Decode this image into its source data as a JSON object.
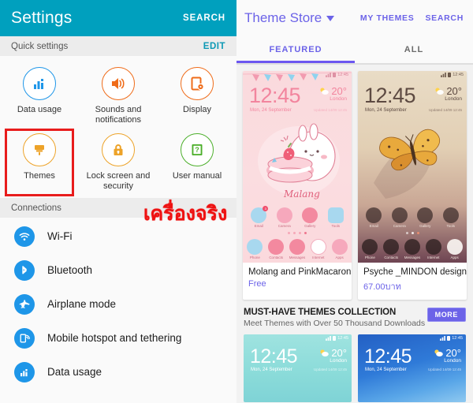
{
  "settings": {
    "header": {
      "title": "Settings",
      "search_label": "SEARCH",
      "bg_color": "#00a0be"
    },
    "quick_settings": {
      "section_label": "Quick settings",
      "edit_label": "EDIT",
      "items": [
        {
          "label": "Data usage",
          "icon": "bar-chart-icon",
          "color": "#1e96e8",
          "highlighted": false
        },
        {
          "label": "Sounds and notifications",
          "icon": "speaker-icon",
          "color": "#ef6c1a",
          "highlighted": false
        },
        {
          "label": "Display",
          "icon": "display-icon",
          "color": "#ef6c1a",
          "highlighted": false
        },
        {
          "label": "Themes",
          "icon": "paintbrush-icon",
          "color": "#eda329",
          "highlighted": true
        },
        {
          "label": "Lock screen and security",
          "icon": "lock-icon",
          "color": "#eda329",
          "highlighted": false
        },
        {
          "label": "User manual",
          "icon": "manual-icon",
          "color": "#4caf2b",
          "highlighted": false
        }
      ],
      "highlight_color": "#e81c1c"
    },
    "connections": {
      "section_label": "Connections",
      "items": [
        {
          "label": "Wi-Fi",
          "icon": "wifi-icon"
        },
        {
          "label": "Bluetooth",
          "icon": "bluetooth-icon"
        },
        {
          "label": "Airplane mode",
          "icon": "airplane-icon"
        },
        {
          "label": "Mobile hotspot and tethering",
          "icon": "hotspot-icon"
        },
        {
          "label": "Data usage",
          "icon": "bar-chart-icon"
        }
      ],
      "icon_color": "#1e96e8"
    },
    "annotation": {
      "text": "เครื่องจริง",
      "color": "#ee1111"
    }
  },
  "store": {
    "header": {
      "title": "Theme Store",
      "my_themes_label": "MY THEMES",
      "search_label": "SEARCH",
      "accent_color": "#6c63e8"
    },
    "tabs": [
      {
        "label": "FEATURED",
        "active": true
      },
      {
        "label": "ALL",
        "active": false
      }
    ],
    "cards": [
      {
        "name": "Molang and PinkMacaron",
        "price": "Free",
        "preview": {
          "time": "12:45",
          "date": "Mon, 24 September",
          "temp": "20°",
          "city": "London",
          "updated": "Updated 14/09 12:45",
          "status_time": "12:45",
          "apps_row1": [
            "Email",
            "Camera",
            "Gallery",
            "Tools"
          ],
          "apps_row2": [
            "Phone",
            "Contacts",
            "Messages",
            "Internet",
            "Apps"
          ],
          "badge": "3",
          "brand": "Malang"
        }
      },
      {
        "name": "Psyche _MINDON design",
        "price": "67.00บาท",
        "preview": {
          "time": "12:45",
          "date": "Mon, 24 September",
          "temp": "20°",
          "city": "London",
          "updated": "Updated 14/09 12:45",
          "status_time": "12:45",
          "apps_row1": [
            "Email",
            "Camera",
            "Gallery",
            "Tools"
          ],
          "apps_row2": [
            "Phone",
            "Contacts",
            "Messages",
            "Internet",
            "Apps"
          ]
        }
      }
    ],
    "collection": {
      "title": "MUST-HAVE THEMES COLLECTION",
      "subtitle": "Meet Themes with Over 50 Thousand Downloads",
      "more_label": "MORE",
      "thumbs": [
        {
          "time": "12:45",
          "date": "Mon, 24 September",
          "temp": "20°",
          "city": "London",
          "updated": "Updated 14/09 12:45",
          "status_time": "12:45"
        },
        {
          "time": "12:45",
          "date": "Mon, 24 September",
          "temp": "20°",
          "city": "London",
          "updated": "Updated 14/09 12:45",
          "status_time": "12:45"
        }
      ]
    }
  }
}
